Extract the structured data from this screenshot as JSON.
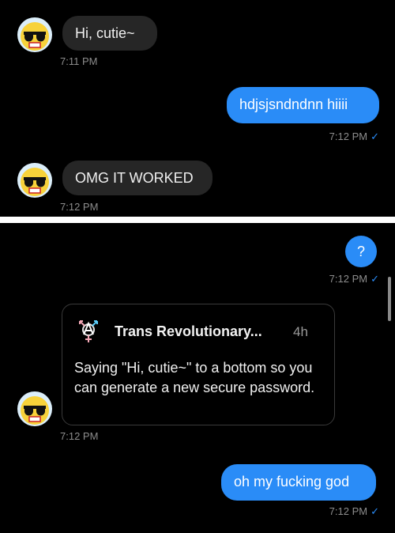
{
  "messages_top": {
    "msg1": {
      "text": "Hi, cutie~",
      "time": "7:11 PM"
    },
    "msg2": {
      "text": "hdjsjsndndnn hiiii",
      "time": "7:12 PM"
    },
    "msg3": {
      "text": "OMG IT WORKED",
      "time": "7:12 PM"
    }
  },
  "messages_bottom": {
    "msg4": {
      "text": "?",
      "time": "7:12 PM"
    },
    "share": {
      "title": "Trans Revolutionary...",
      "age": "4h",
      "body": "Saying \"Hi, cutie~\" to a bottom so you can generate a new secure password.",
      "time": "7:12 PM"
    },
    "msg5": {
      "text": "oh my fucking god",
      "time": "7:12 PM"
    }
  },
  "read_mark": "✓",
  "colors": {
    "outgoing": "#2a8cf7",
    "incoming": "#262626",
    "background": "#000000",
    "timestamp": "#8d8d8d"
  }
}
